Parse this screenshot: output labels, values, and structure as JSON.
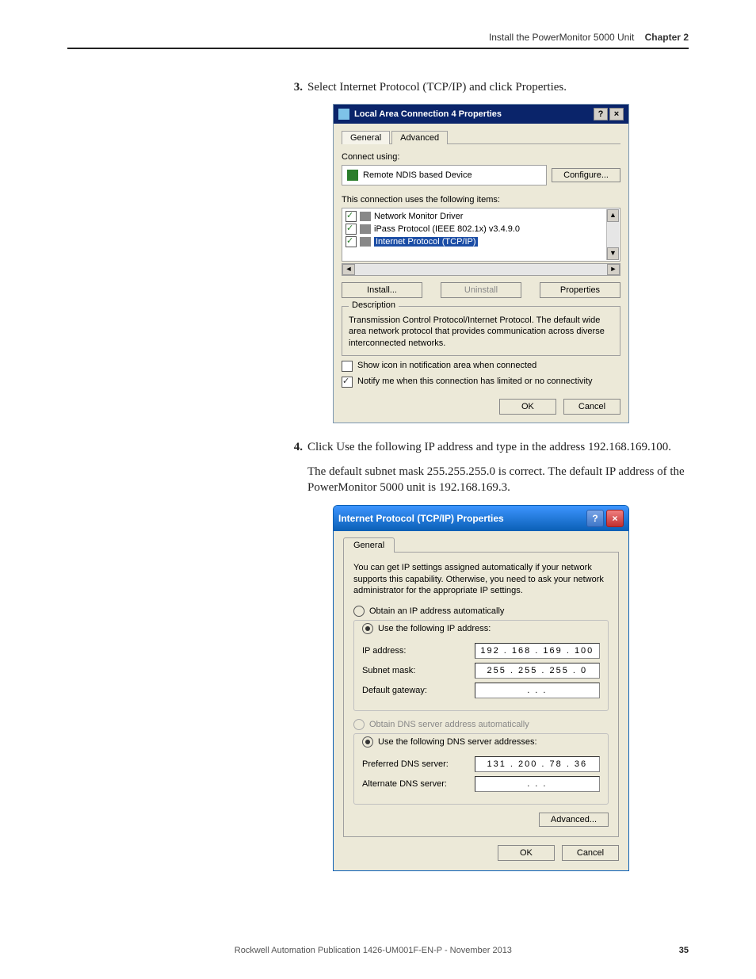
{
  "header": {
    "breadcrumb_title": "Install the PowerMonitor 5000 Unit",
    "breadcrumb_chapter": "Chapter 2"
  },
  "step3": {
    "num": "3.",
    "text": "Select Internet Protocol (TCP/IP) and click Properties."
  },
  "dialog1": {
    "title": "Local Area Connection 4 Properties",
    "help_btn": "?",
    "close_btn": "×",
    "tab_general": "General",
    "tab_advanced": "Advanced",
    "connect_using_label": "Connect using:",
    "device_name": "Remote NDIS based Device",
    "configure_btn": "Configure...",
    "items_label": "This connection uses the following items:",
    "item1": "Network Monitor Driver",
    "item2": "iPass Protocol (IEEE 802.1x) v3.4.9.0",
    "item3": "Internet Protocol (TCP/IP)",
    "install_btn": "Install...",
    "uninstall_btn": "Uninstall",
    "properties_btn": "Properties",
    "description_label": "Description",
    "description_text": "Transmission Control Protocol/Internet Protocol. The default wide area network protocol that provides communication across diverse interconnected networks.",
    "show_icon_label": "Show icon in notification area when connected",
    "notify_label": "Notify me when this connection has limited or no connectivity",
    "ok_btn": "OK",
    "cancel_btn": "Cancel"
  },
  "step4": {
    "num": "4.",
    "text": "Click Use the following IP address and type in the address 192.168.169.100."
  },
  "para_note": "The default subnet mask 255.255.255.0 is correct. The default IP address of the PowerMonitor 5000 unit is 192.168.169.3.",
  "dialog2": {
    "title": "Internet Protocol (TCP/IP) Properties",
    "help_btn": "?",
    "close_btn": "×",
    "tab_general": "General",
    "explain": "You can get IP settings assigned automatically if your network supports this capability. Otherwise, you need to ask your network administrator for the appropriate IP settings.",
    "radio_obtain_ip": "Obtain an IP address automatically",
    "radio_use_ip": "Use the following IP address:",
    "ip_label": "IP address:",
    "ip_value": "192 . 168 . 169 . 100",
    "subnet_label": "Subnet mask:",
    "subnet_value": "255 . 255 . 255 .  0",
    "gateway_label": "Default gateway:",
    "gateway_value": " .  .  . ",
    "radio_obtain_dns": "Obtain DNS server address automatically",
    "radio_use_dns": "Use the following DNS server addresses:",
    "pref_dns_label": "Preferred DNS server:",
    "pref_dns_value": "131 . 200 .  78 .  36",
    "alt_dns_label": "Alternate DNS server:",
    "alt_dns_value": " .  .  . ",
    "advanced_btn": "Advanced...",
    "ok_btn": "OK",
    "cancel_btn": "Cancel"
  },
  "footer": {
    "publication": "Rockwell Automation Publication 1426-UM001F-EN-P - November 2013",
    "page": "35"
  }
}
